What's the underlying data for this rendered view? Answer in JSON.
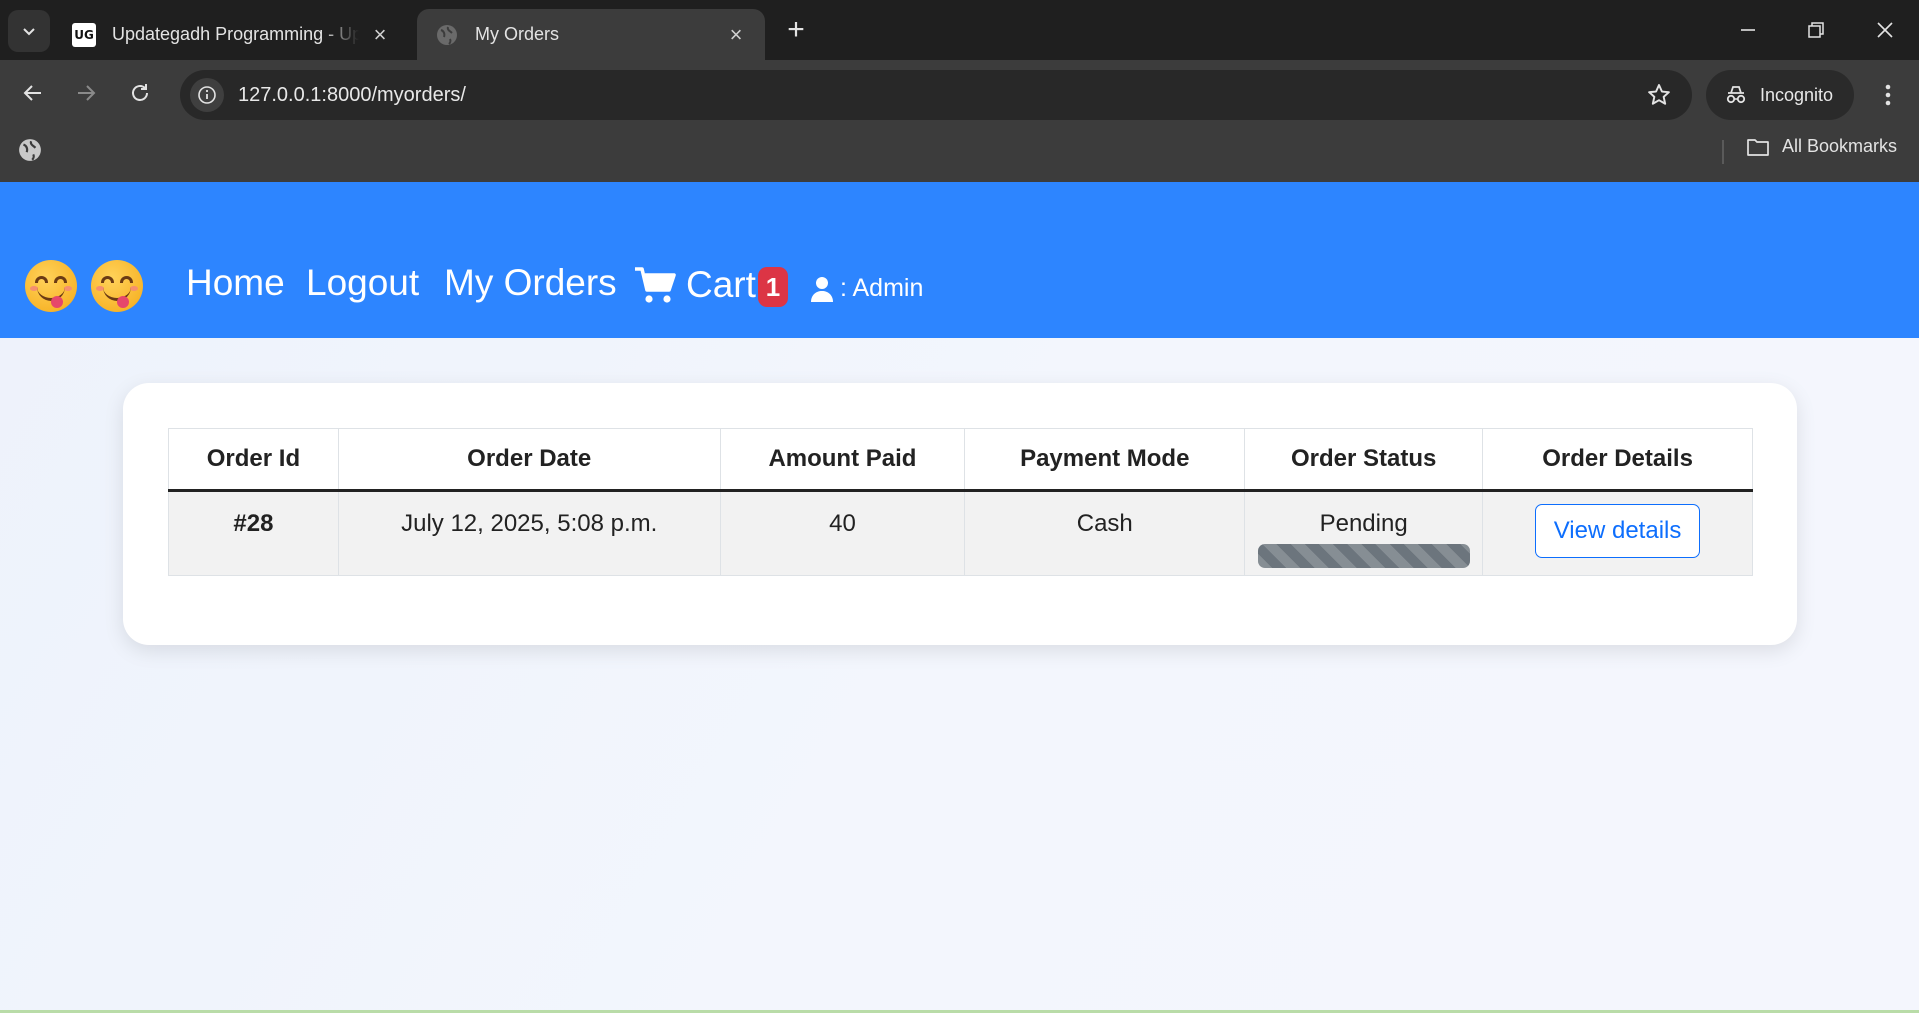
{
  "browser": {
    "tabs": [
      {
        "title": "Updategadh Programming - Up",
        "favicon": "ug-logo-icon",
        "active": false
      },
      {
        "title": "My Orders",
        "favicon": "globe-icon",
        "active": true
      }
    ],
    "favicon_ug_text": "UG",
    "new_tab_icon": "plus-icon",
    "url": "127.0.0.1:8000/myorders/",
    "incognito_label": "Incognito",
    "all_bookmarks_label": "All Bookmarks"
  },
  "navbar": {
    "emojis": [
      "😋",
      "😋"
    ],
    "links": {
      "home": "Home",
      "logout": "Logout",
      "my_orders": "My Orders"
    },
    "cart_label": "Cart",
    "cart_count": "1",
    "user_label": ": Admin",
    "colors": {
      "navbar_bg": "#2d85ff",
      "badge_bg": "#dc3545"
    }
  },
  "orders": {
    "headers": {
      "order_id": "Order Id",
      "order_date": "Order Date",
      "amount_paid": "Amount Paid",
      "payment_mode": "Payment Mode",
      "order_status": "Order Status",
      "order_details": "Order Details"
    },
    "rows": [
      {
        "order_id": "#28",
        "order_date": "July 12, 2025, 5:08 p.m.",
        "amount_paid": "40",
        "payment_mode": "Cash",
        "order_status": "Pending",
        "status_progress_percent": 100,
        "details_button": "View details"
      }
    ]
  }
}
